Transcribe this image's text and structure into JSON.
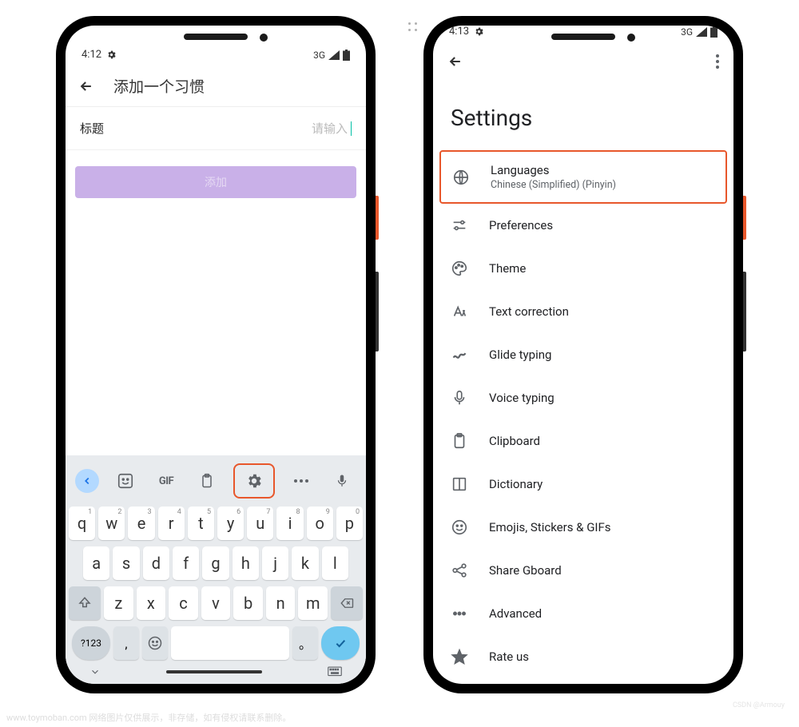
{
  "phone1": {
    "statusBar": {
      "time": "4:12",
      "network": "3G"
    },
    "app": {
      "title": "添加一个习惯",
      "field_label": "标题",
      "field_placeholder": "请输入",
      "add_button": "添加"
    },
    "keyboard": {
      "toolbar": [
        "chevron",
        "sticker",
        "GIF",
        "clipboard",
        "settings",
        "more",
        "mic"
      ],
      "row1": [
        {
          "k": "q",
          "s": "1"
        },
        {
          "k": "w",
          "s": "2"
        },
        {
          "k": "e",
          "s": "3"
        },
        {
          "k": "r",
          "s": "4"
        },
        {
          "k": "t",
          "s": "5"
        },
        {
          "k": "y",
          "s": "6"
        },
        {
          "k": "u",
          "s": "7"
        },
        {
          "k": "i",
          "s": "8"
        },
        {
          "k": "o",
          "s": "9"
        },
        {
          "k": "p",
          "s": "0"
        }
      ],
      "row2": [
        "a",
        "s",
        "d",
        "f",
        "g",
        "h",
        "j",
        "k",
        "l"
      ],
      "row3": [
        "z",
        "x",
        "c",
        "v",
        "b",
        "n",
        "m"
      ],
      "sym_key": "?123",
      "comma": ",",
      "period": "。"
    }
  },
  "phone2": {
    "statusBar": {
      "time": "4:13",
      "network": "3G"
    },
    "settings": {
      "title": "Settings",
      "items": [
        {
          "label": "Languages",
          "sub": "Chinese (Simplified) (Pinyin)",
          "icon": "globe",
          "highlighted": true
        },
        {
          "label": "Preferences",
          "icon": "sliders"
        },
        {
          "label": "Theme",
          "icon": "palette"
        },
        {
          "label": "Text correction",
          "icon": "text-a"
        },
        {
          "label": "Glide typing",
          "icon": "glide"
        },
        {
          "label": "Voice typing",
          "icon": "mic"
        },
        {
          "label": "Clipboard",
          "icon": "clipboard"
        },
        {
          "label": "Dictionary",
          "icon": "book"
        },
        {
          "label": "Emojis, Stickers & GIFs",
          "icon": "emoji"
        },
        {
          "label": "Share Gboard",
          "icon": "share"
        },
        {
          "label": "Advanced",
          "icon": "dots"
        },
        {
          "label": "Rate us",
          "icon": "star"
        }
      ]
    }
  },
  "watermark": "www.toymoban.com 网络图片仅供展示，非存储，如有侵权请联系删除。",
  "watermark_right": "CSDN @Armouy"
}
